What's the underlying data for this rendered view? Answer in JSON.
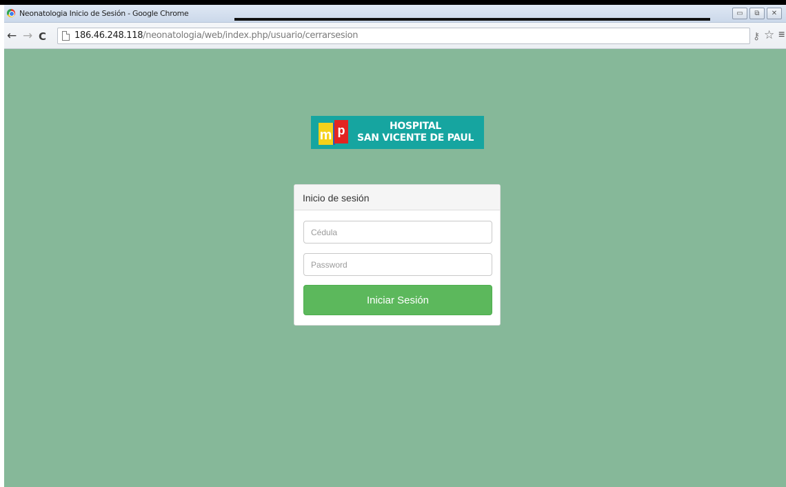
{
  "window": {
    "title": "Neonatologia Inicio de Sesión - Google Chrome",
    "controls": {
      "minimize": "▭",
      "restore": "⧉",
      "close": "✕"
    }
  },
  "toolbar": {
    "back_icon": "←",
    "forward_icon": "→",
    "reload_icon": "C",
    "url_host": "186.46.248.118",
    "url_path": "/neonatologia/web/index.php/usuario/cerrarsesion",
    "key_icon": "⚷",
    "star_icon": "☆",
    "menu_icon": "≡"
  },
  "page": {
    "background_color": "#86b899",
    "logo": {
      "letters_m": "m",
      "letters_p": "p",
      "line1": "HOSPITAL",
      "line2": "SAN VICENTE DE PAUL",
      "background_color": "#16a5a0"
    },
    "login": {
      "header": "Inicio de sesión",
      "cedula_placeholder": "Cédula",
      "password_placeholder": "Password",
      "submit_label": "Iniciar Sesión",
      "button_color": "#5cb85c"
    }
  }
}
